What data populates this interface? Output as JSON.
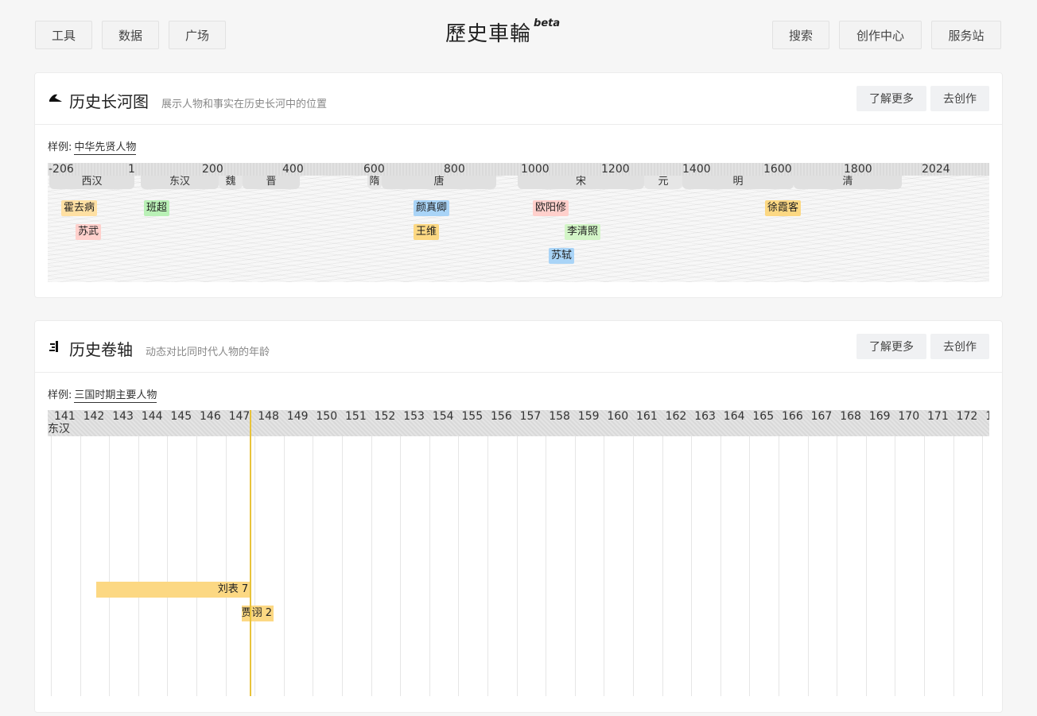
{
  "nav": {
    "left": [
      "工具",
      "数据",
      "广场"
    ],
    "right": [
      "搜索",
      "创作中心",
      "服务站"
    ]
  },
  "logo": {
    "text": "歷史車輪",
    "badge": "beta"
  },
  "river_card": {
    "icon": "brush-icon",
    "title": "历史长河图",
    "subtitle": "展示人物和事实在历史长河中的位置",
    "learn_more": "了解更多",
    "create": "去创作",
    "example_label": "样例:",
    "example_link": "中华先贤人物",
    "ticks": [
      "-206",
      "1",
      "200",
      "400",
      "600",
      "800",
      "1000",
      "1200",
      "1400",
      "1600",
      "1800",
      "2024"
    ],
    "dynasties": [
      "西汉",
      "东汉",
      "魏",
      "晋",
      "隋",
      "唐",
      "宋",
      "元",
      "明",
      "清"
    ],
    "people": [
      {
        "name": "霍去病",
        "color": "#ffe0a3"
      },
      {
        "name": "苏武",
        "color": "#ffd0cc"
      },
      {
        "name": "班超",
        "color": "#b9f0b6"
      },
      {
        "name": "颜真卿",
        "color": "#a9d4f7"
      },
      {
        "name": "王维",
        "color": "#fcd883"
      },
      {
        "name": "欧阳修",
        "color": "#ffd0cc"
      },
      {
        "name": "李清照",
        "color": "#d3f5c7"
      },
      {
        "name": "苏轼",
        "color": "#a9d4f7"
      },
      {
        "name": "徐霞客",
        "color": "#fcd883"
      }
    ]
  },
  "scroll_card": {
    "icon": "scroll-icon",
    "title": "历史卷轴",
    "subtitle": "动态对比同时代人物的年龄",
    "learn_more": "了解更多",
    "create": "去创作",
    "example_label": "样例:",
    "example_link": "三国时期主要人物",
    "years": [
      "141",
      "142",
      "143",
      "144",
      "145",
      "146",
      "147",
      "148",
      "149",
      "150",
      "151",
      "152",
      "153",
      "154",
      "155",
      "156",
      "157",
      "158",
      "159",
      "160",
      "161",
      "162",
      "163",
      "164",
      "165",
      "166",
      "167",
      "168",
      "169",
      "170",
      "171",
      "172",
      "1"
    ],
    "era": "东汉",
    "current_year": 148,
    "bars": [
      {
        "name": "刘表",
        "age": "7",
        "from": 142,
        "to": 148
      },
      {
        "name": "贾诩",
        "age": "2",
        "from": 147,
        "to": 148
      }
    ],
    "accent": "#e8c33a"
  }
}
